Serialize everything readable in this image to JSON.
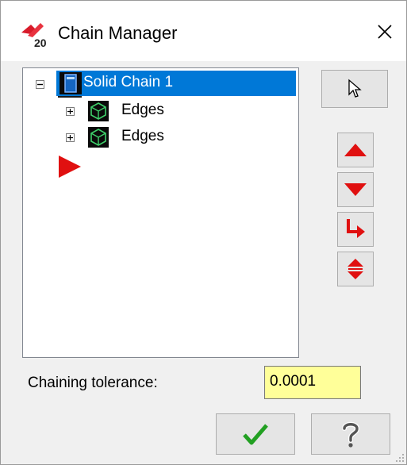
{
  "window": {
    "title": "Chain Manager"
  },
  "tree": {
    "root": {
      "label": "Solid Chain 1",
      "expanded": true,
      "icon": "solid-chain-icon"
    },
    "children": [
      {
        "label": "Edges",
        "icon": "edges-cube-icon",
        "expanded": false
      },
      {
        "label": "Edges",
        "icon": "edges-cube-icon",
        "expanded": false
      }
    ],
    "insert_marker": "red-arrow-marker"
  },
  "side_buttons": [
    {
      "icon": "select-pointer-icon"
    },
    {
      "icon": "move-up-icon"
    },
    {
      "icon": "move-down-icon"
    },
    {
      "icon": "reverse-icon"
    },
    {
      "icon": "swap-icon"
    }
  ],
  "tolerance": {
    "label": "Chaining tolerance:",
    "value": "0.0001"
  },
  "footer": {
    "ok_icon": "check-icon",
    "help_icon": "question-icon"
  },
  "colors": {
    "selection": "#0078d7",
    "accent_red": "#e01010",
    "input_bg": "#ffff99",
    "check_green": "#22a022"
  }
}
